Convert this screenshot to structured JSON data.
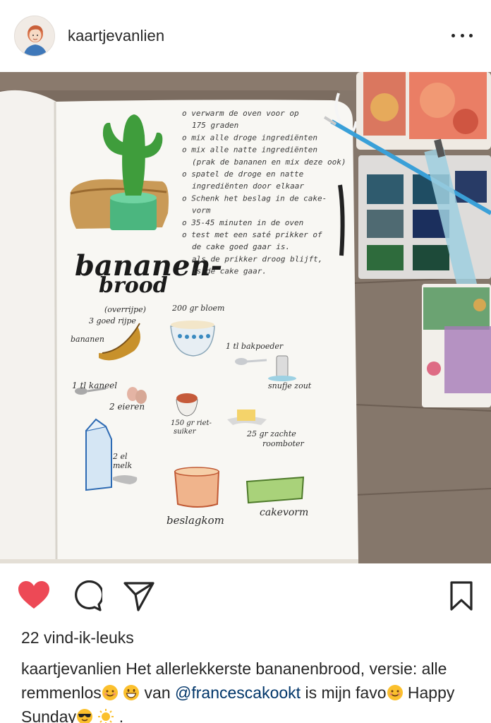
{
  "post": {
    "username": "kaartjevanlien",
    "likes": "22 vind-ik-leuks",
    "caption": {
      "username": "kaartjevanlien",
      "text_1": " Het allerlekkerste bananenbrood, versie: alle remmenlos",
      "text_2": " van ",
      "mention": "@francescakookt",
      "text_3": " is mijn favo",
      "text_4": " Happy Sunday",
      "text_5": " ."
    }
  },
  "icons": {
    "like": "heart-icon",
    "comment": "comment-icon",
    "share": "send-icon",
    "save": "bookmark-icon",
    "more": "more-icon"
  },
  "colors": {
    "heart": "#ed4956",
    "mention": "#003569",
    "text": "#262626"
  },
  "recipe_page": {
    "title_line_1": "bananen-",
    "title_line_2": "brood",
    "steps": [
      "o verwarm de oven voor op",
      "175 graden",
      "o mix alle droge ingrediënten",
      "o mix alle natte ingrediënten",
      "(prak de bananen en mix deze ook)",
      "o spatel de droge en natte",
      "ingrediënten door elkaar",
      "o Schenk het beslag in de cake-",
      "vorm",
      "o 35-45 minuten in de oven",
      "o test met een saté prikker of",
      "de cake goed gaar is.",
      "als de prikker droog blijft,",
      "is de cake gaar."
    ],
    "labels": {
      "bananas_1": "(overrijpe)",
      "bananas_2": "3 goed rijpe",
      "bananas_3": "bananen",
      "flour": "200 gr bloem",
      "baking_powder": "1 tl bakpoeder",
      "salt": "snufje zout",
      "cinnamon": "1 tl kaneel",
      "eggs": "2 eieren",
      "sugar_1": "150 gr riet-",
      "sugar_2": "suiker",
      "butter_1": "25 gr zachte",
      "butter_2": "roomboter",
      "milk_1": "2 el",
      "milk_2": "melk",
      "bowl": "beslagkom",
      "cake_tin": "cakevorm"
    }
  }
}
